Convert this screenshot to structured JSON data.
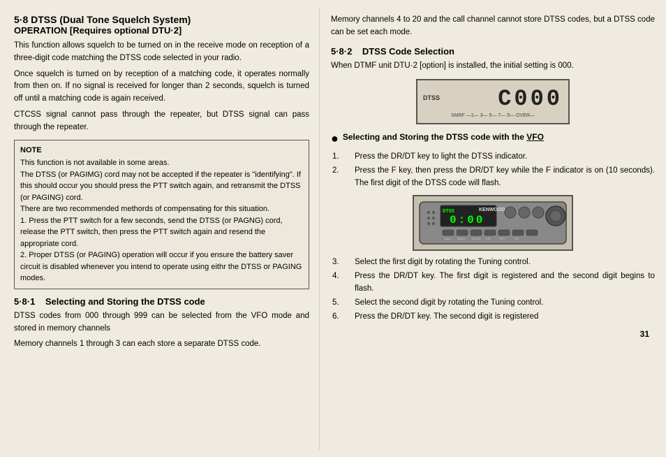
{
  "page": {
    "number": "31",
    "left": {
      "section_header": "5·8   DTSS    (Dual Tone Squelch System)",
      "section_subheader": "OPERATION [Requires optional DTU·2]",
      "intro_paragraphs": [
        "This function allows squelch to be turned on in the receive mode on reception of a three-digit code matching the DTSS code selected in your radio.",
        "Once squelch is turned on by reception of a matching code, it operates normally from then on. If no signal is received for longer than 2 seconds, squelch is turned off until a matching code is again received.",
        "CTCSS signal cannot pass through the repeater, but DTSS signal can pass through the repeater."
      ],
      "note": {
        "title": "NOTE",
        "lines": [
          "This function is not available in some areas.",
          "The DTSS (or PAGIMG) cord may not be accepted if the repeater is \"identifying\". If this should occur you should press the PTT switch again, and retransmit the DTSS (or PAGING) cord.",
          "There are two recommended methords of compensating for this situation.",
          "1. Press the PTT switch for a few seconds, send the DTSS (or PAGNG) cord, release the PTT switch, then press the PTT switch again and resend the appropriate cord.",
          "2. Proper DTSS (or PAGING) operation will occur if you ensure the battery saver circuit is disabled whenever you intend to operate using eithr the DTSS or PAGING modes."
        ]
      },
      "subsection": {
        "number": "5·8·1",
        "title": "Selecting and Storing the DTSS code",
        "text1": "DTSS codes from 000 through 999 can be selected from the VFO mode and stored in memory channels",
        "text2": "Memory channels 1 through 3 can each store a separate DTSS code."
      }
    },
    "right": {
      "text_top": "Memory channels 4 to 20 and the call channel cannot store DTSS codes, but a DTSS code can be set each mode.",
      "subsection_number": "5·8·2",
      "subsection_title": "DTSS Code Selection",
      "setting_text": "When DTMF unit DTU·2 [option] is installed, the initial setting is 000.",
      "display": {
        "label": "DTSS",
        "digits": "C000",
        "bar": "SMRF  —1—  3—  5—  7—  9—  OVER—"
      },
      "bullet_title": "● Selecting  and  Storing  the  DTSS  code  with the VFO",
      "steps": [
        "1. Press the DR/DT key to light the DTSS indicator.",
        "2. Press the F key, then press the DR/DT key while the F indicator is on (10 seconds). The first digit of the DTSS code will flash.",
        "3. Select the first digit by rotating the Tuning control.",
        "4. Press the DR/DT key. The first digit is registered and the second digit begins to flash.",
        "5. Select  the  second  digit  by  rotating  the  Tuning control.",
        "6. Press the DR/DT key. The second digit is registered"
      ]
    }
  }
}
